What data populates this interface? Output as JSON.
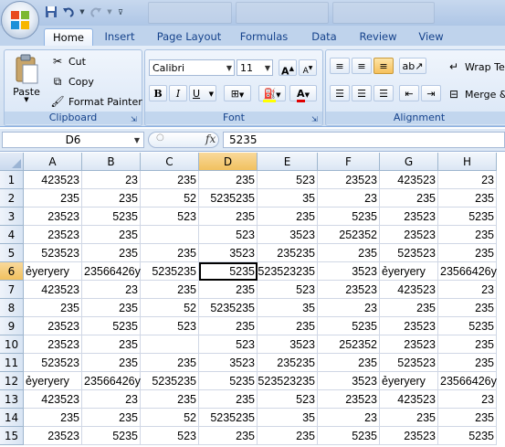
{
  "quick_access": {
    "save": "save-icon",
    "undo": "undo-icon",
    "redo": "redo-icon"
  },
  "tabs": [
    "Home",
    "Insert",
    "Page Layout",
    "Formulas",
    "Data",
    "Review",
    "View"
  ],
  "clipboard": {
    "paste": "Paste",
    "cut": "Cut",
    "copy": "Copy",
    "format_painter": "Format Painter",
    "label": "Clipboard"
  },
  "font": {
    "name": "Calibri",
    "size": "11",
    "label": "Font",
    "bold": "B",
    "italic": "I",
    "underline": "U",
    "grow": "A",
    "shrink": "A",
    "color_letter": "A"
  },
  "alignment": {
    "wrap": "Wrap Tex",
    "merge": "Merge &",
    "label": "Alignment"
  },
  "name_box": "D6",
  "formula_value": "5235",
  "fx_label": "fx",
  "columns": [
    "A",
    "B",
    "C",
    "D",
    "E",
    "F",
    "G",
    "H"
  ],
  "rows": [
    {
      "n": "1",
      "c": [
        "423523",
        "23",
        "235",
        "235",
        "523",
        "23523",
        "423523",
        "23"
      ]
    },
    {
      "n": "2",
      "c": [
        "235",
        "235",
        "52",
        "5235235",
        "35",
        "23",
        "235",
        "235"
      ]
    },
    {
      "n": "3",
      "c": [
        "23523",
        "5235",
        "523",
        "235",
        "235",
        "5235",
        "23523",
        "5235"
      ]
    },
    {
      "n": "4",
      "c": [
        "23523",
        "235",
        "",
        "523",
        "3523",
        "252352",
        "23523",
        "235"
      ]
    },
    {
      "n": "5",
      "c": [
        "523523",
        "235",
        "235",
        "3523",
        "235235",
        "235",
        "523523",
        "235"
      ]
    },
    {
      "n": "6",
      "c": [
        "ẻyeryery",
        "23566426y",
        "5235235",
        "5235",
        "523523235",
        "3523",
        "ẻyeryery",
        "23566426y"
      ]
    },
    {
      "n": "7",
      "c": [
        "423523",
        "23",
        "235",
        "235",
        "523",
        "23523",
        "423523",
        "23"
      ]
    },
    {
      "n": "8",
      "c": [
        "235",
        "235",
        "52",
        "5235235",
        "35",
        "23",
        "235",
        "235"
      ]
    },
    {
      "n": "9",
      "c": [
        "23523",
        "5235",
        "523",
        "235",
        "235",
        "5235",
        "23523",
        "5235"
      ]
    },
    {
      "n": "10",
      "c": [
        "23523",
        "235",
        "",
        "523",
        "3523",
        "252352",
        "23523",
        "235"
      ]
    },
    {
      "n": "11",
      "c": [
        "523523",
        "235",
        "235",
        "3523",
        "235235",
        "235",
        "523523",
        "235"
      ]
    },
    {
      "n": "12",
      "c": [
        "ẻyeryery",
        "23566426y",
        "5235235",
        "5235",
        "523523235",
        "3523",
        "ẻyeryery",
        "23566426y"
      ]
    },
    {
      "n": "13",
      "c": [
        "423523",
        "23",
        "235",
        "235",
        "523",
        "23523",
        "423523",
        "23"
      ]
    },
    {
      "n": "14",
      "c": [
        "235",
        "235",
        "52",
        "5235235",
        "35",
        "23",
        "235",
        "235"
      ]
    },
    {
      "n": "15",
      "c": [
        "23523",
        "5235",
        "523",
        "235",
        "235",
        "5235",
        "23523",
        "5235"
      ]
    }
  ],
  "active_cell": {
    "row": "6",
    "col": "D"
  }
}
